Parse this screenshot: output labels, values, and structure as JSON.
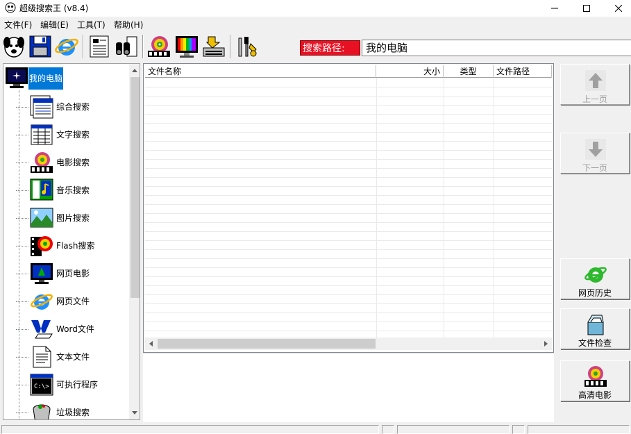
{
  "window": {
    "title": "超级搜索王 (v8.4)"
  },
  "menu": [
    "文件(F)",
    "编辑(E)",
    "工具(T)",
    "帮助(H)"
  ],
  "toolbar": {
    "path_label": "搜索路径:",
    "path_value": "我的电脑"
  },
  "tree": {
    "root": "我的电脑",
    "items": [
      "综合搜索",
      "文字搜索",
      "电影搜索",
      "音乐搜索",
      "图片搜索",
      "Flash搜索",
      "网页电影",
      "网页文件",
      "Word文件",
      "文本文件",
      "可执行程序",
      "垃圾搜索"
    ]
  },
  "list": {
    "columns": [
      "文件名称",
      "大小",
      "类型",
      "文件路径"
    ]
  },
  "side": {
    "prev": "上一页",
    "next": "下一页",
    "history": "网页历史",
    "check": "文件检查",
    "hd": "高清电影"
  },
  "colors": {
    "selected": "#0078d7",
    "path_label_bg": "#e81123"
  }
}
